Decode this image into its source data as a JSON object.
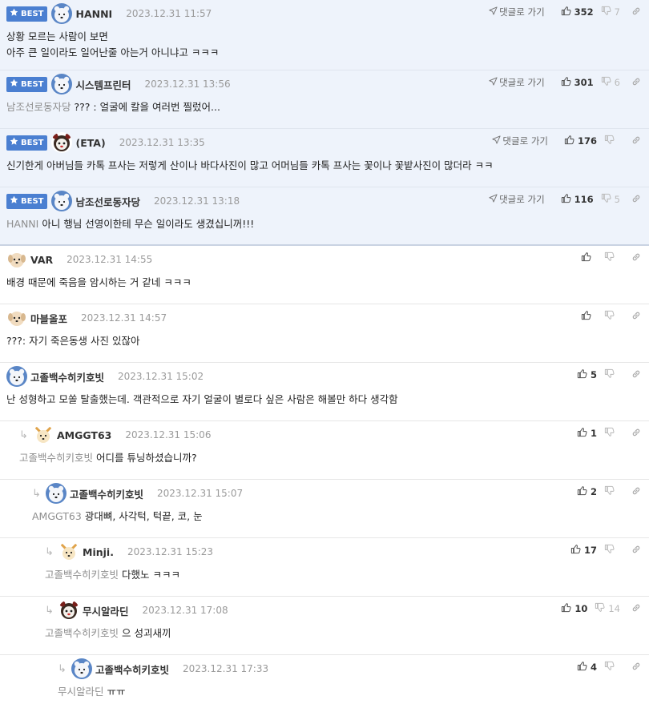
{
  "comments": [
    {
      "best": true,
      "badge": "BEST",
      "avatar": "white-bear-avatar",
      "nick": "HANNI",
      "date": "2023.12.31 11:57",
      "goto": "댓글로 가기",
      "up": "352",
      "down": "7",
      "mention": "",
      "lines": [
        "상황 모르는 사람이 보면",
        "아주 큰 일이라도 일어난줄 아는거 아니냐고 ㅋㅋㅋ"
      ]
    },
    {
      "best": true,
      "badge": "BEST",
      "avatar": "white-bear-avatar",
      "nick": "시스템프린터",
      "date": "2023.12.31 13:56",
      "goto": "댓글로 가기",
      "up": "301",
      "down": "6",
      "mention": "남조선로동자당",
      "lines": [
        "??? : 얼굴에 칼을 여러번 찔렀어..."
      ]
    },
    {
      "best": true,
      "badge": "BEST",
      "avatar": "panda-avatar",
      "nick": "(ETA)",
      "date": "2023.12.31 13:35",
      "goto": "댓글로 가기",
      "up": "176",
      "down": "",
      "mention": "",
      "lines": [
        "신기한게 아버님들 카톡 프사는 저렇게 산이나 바다사진이 많고 어머님들 카톡 프사는 꽃이나 꽃밭사진이 많더라 ㅋㅋ"
      ]
    },
    {
      "best": true,
      "last_best": true,
      "badge": "BEST",
      "avatar": "white-bear-avatar",
      "nick": "남조선로동자당",
      "date": "2023.12.31 13:18",
      "goto": "댓글로 가기",
      "up": "116",
      "down": "5",
      "mention": "HANNI",
      "lines": [
        "아니 행님 선영이한테 무슨 일이라도 생겼십니꺼!!!"
      ]
    },
    {
      "depth": 0,
      "avatar": "puppy-avatar",
      "nick": "VAR",
      "date": "2023.12.31 14:55",
      "up": "",
      "down": "",
      "mention": "",
      "lines": [
        "배경 때문에 죽음을 암시하는 거 같네 ㅋㅋㅋ"
      ]
    },
    {
      "depth": 0,
      "avatar": "puppy-avatar",
      "nick": "마블올포",
      "date": "2023.12.31 14:57",
      "up": "",
      "down": "",
      "mention": "",
      "lines": [
        "???: 자기 죽은동생 사진 있잖아"
      ]
    },
    {
      "depth": 0,
      "avatar": "white-bear-avatar",
      "nick": "고졸백수히키호빗",
      "date": "2023.12.31 15:02",
      "up": "5",
      "down": "",
      "mention": "",
      "lines": [
        "난 성형하고 모쏠 탈출했는데. 객관적으로 자기 얼굴이 별로다 싶은 사람은 해볼만 하다 생각함"
      ]
    },
    {
      "depth": 1,
      "avatar": "fox-avatar",
      "nick": "AMGGT63",
      "date": "2023.12.31 15:06",
      "up": "1",
      "down": "",
      "mention": "고졸백수히키호빗",
      "lines": [
        "어디를 튜닝하셨습니까?"
      ]
    },
    {
      "depth": 2,
      "avatar": "white-bear-avatar",
      "nick": "고졸백수히키호빗",
      "date": "2023.12.31 15:07",
      "up": "2",
      "down": "",
      "mention": "AMGGT63",
      "lines": [
        "광대뼈, 사각턱, 턱끝, 코, 눈"
      ]
    },
    {
      "depth": 3,
      "avatar": "fox-avatar",
      "nick": "Minji.",
      "date": "2023.12.31 15:23",
      "up": "17",
      "down": "",
      "mention": "고졸백수히키호빗",
      "lines": [
        "다했노 ㅋㅋㅋ"
      ]
    },
    {
      "depth": 3,
      "avatar": "panda-avatar",
      "nick": "무시알라딘",
      "date": "2023.12.31 17:08",
      "up": "10",
      "down": "14",
      "mention": "고졸백수히키호빗",
      "lines": [
        "으 성괴새끼"
      ]
    },
    {
      "depth": 4,
      "avatar": "white-bear-avatar",
      "nick": "고졸백수히키호빗",
      "date": "2023.12.31 17:33",
      "up": "4",
      "down": "",
      "mention": "무시알라딘",
      "lines": [
        "ㅠㅠ"
      ]
    }
  ],
  "reply_arrow": "↳",
  "colors": {
    "best_bg": "#eef3fb",
    "badge": "#4a7fd1",
    "date": "#9a9a9a",
    "mention": "#8e8e8e"
  }
}
